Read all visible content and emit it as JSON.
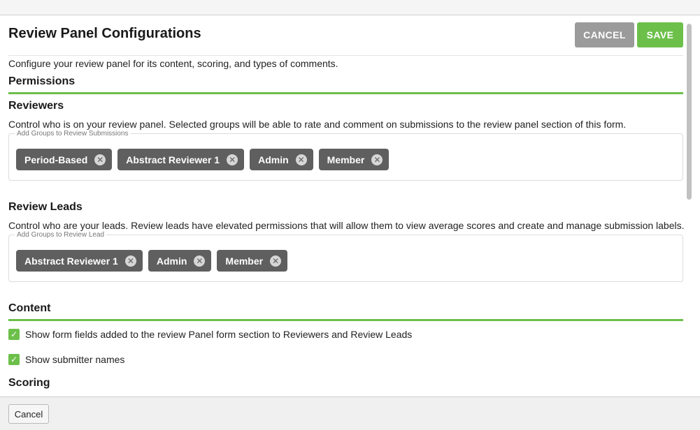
{
  "dialog": {
    "title": "Review Panel Configurations",
    "cancel_label": "CANCEL",
    "save_label": "SAVE",
    "description": "Configure your review panel for its content, scoring, and types of comments."
  },
  "permissions": {
    "title": "Permissions",
    "reviewers": {
      "title": "Reviewers",
      "description": "Control who is on your review panel. Selected groups will be able to rate and comment on submissions to the review panel section of this form.",
      "field_label": "Add Groups to Review Submissions",
      "chips": [
        "Period-Based",
        "Abstract Reviewer 1",
        "Admin",
        "Member"
      ]
    },
    "review_leads": {
      "title": "Review Leads",
      "description": "Control who are your leads. Review leads have elevated permissions that will allow them to view average scores and create and manage submission labels.",
      "field_label": "Add Groups to Review Lead",
      "chips": [
        "Abstract Reviewer 1",
        "Admin",
        "Member"
      ]
    }
  },
  "content": {
    "title": "Content",
    "options": [
      {
        "label": "Show form fields added to the review Panel form section to Reviewers and Review Leads",
        "checked": true
      },
      {
        "label": "Show submitter names",
        "checked": true
      }
    ]
  },
  "scoring": {
    "title": "Scoring"
  },
  "footer": {
    "cancel_label": "Cancel"
  },
  "icons": {
    "chip_remove": "close-circle-icon",
    "checkbox": "check-icon"
  },
  "colors": {
    "accent_green": "#6cc04a",
    "chip_gray": "#5f5f5f",
    "cancel_gray": "#9b9b9b"
  }
}
